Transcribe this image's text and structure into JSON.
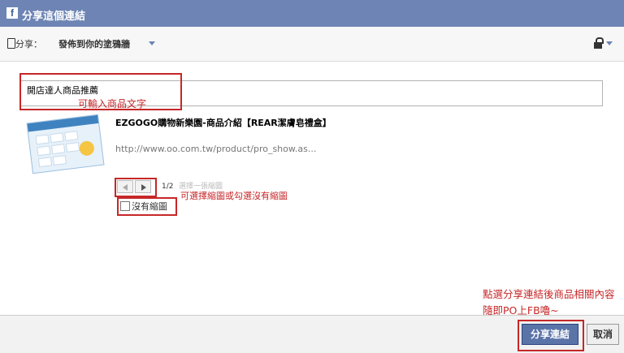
{
  "dialog": {
    "title": "分享這個連結",
    "fb_logo": "f"
  },
  "share_bar": {
    "label": "分享：",
    "target": "發佈到你的塗鴉牆"
  },
  "message": {
    "value": "開店達人商品推薦",
    "annotation": "可輸入商品文字"
  },
  "link": {
    "title": "EZGOGO購物新樂園-商品介紹【REAR潔膚皂禮盒】",
    "url": "http://www.oo.com.tw/product/pro_show.as..."
  },
  "thumbnail": {
    "pager": "1/2",
    "choose_label": "選擇一張縮圖",
    "no_thumbnail_label": "沒有縮圖",
    "annotation": "可選擇縮圖或勾選沒有縮圖"
  },
  "annotations": {
    "final_note": "點選分享連結後商品相關內容隨即PO上FB嚕~"
  },
  "buttons": {
    "share": "分享連結",
    "cancel": "取消"
  },
  "colors": {
    "header": "#6d84b4",
    "annotation": "#c62728",
    "share_button": "#5b74a8"
  },
  "icons": [
    "facebook-logo-icon",
    "share-to-icon",
    "chevron-down-icon",
    "lock-icon",
    "prev-arrow-icon",
    "next-arrow-icon",
    "checkbox-icon"
  ]
}
